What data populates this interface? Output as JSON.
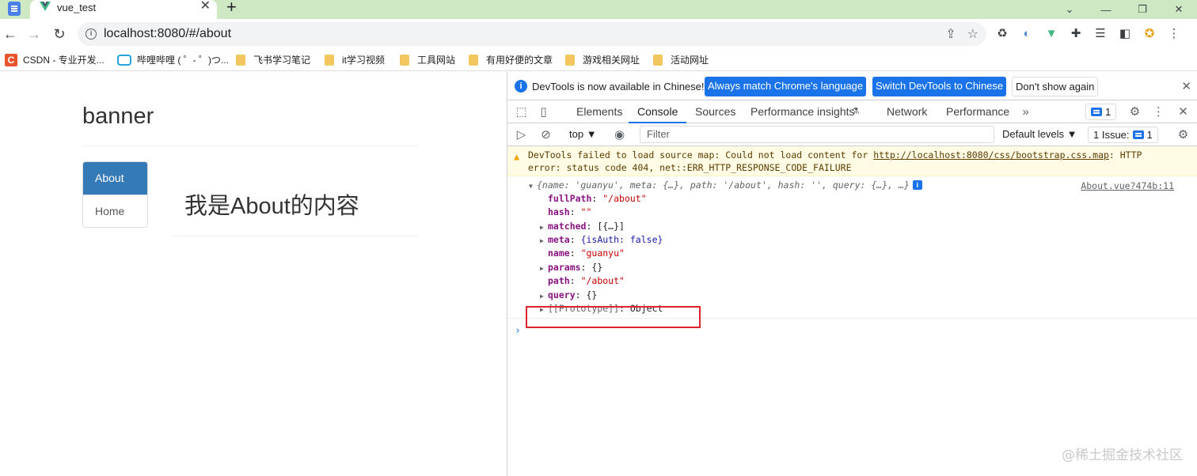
{
  "browser": {
    "tab_title": "vue_test",
    "url": "localhost:8080/#/about",
    "new_tab": "+",
    "close": "✕"
  },
  "bookmarks": [
    {
      "label": "CSDN - 专业开发..."
    },
    {
      "label": "哔哩哔哩 ( ゜- ゜)つ..."
    },
    {
      "label": "飞书学习笔记"
    },
    {
      "label": "it学习视频"
    },
    {
      "label": "工具网站"
    },
    {
      "label": "有用好便的文章"
    },
    {
      "label": "游戏相关网址"
    },
    {
      "label": "活动网址"
    }
  ],
  "page": {
    "banner": "banner",
    "nav": [
      {
        "label": "About",
        "active": true
      },
      {
        "label": "Home",
        "active": false
      }
    ],
    "content": "我是About的内容"
  },
  "devtools": {
    "infobar": {
      "text": "DevTools is now available in Chinese!",
      "btn_match": "Always match Chrome's language",
      "btn_switch": "Switch DevTools to Chinese",
      "btn_dismiss": "Don't show again"
    },
    "tabs": [
      "Elements",
      "Console",
      "Sources",
      "Performance insights",
      "Network",
      "Performance"
    ],
    "active_tab": "Console",
    "message_count": "1",
    "context": "top",
    "filter_placeholder": "Filter",
    "levels": "Default levels",
    "issues": "1 Issue:",
    "issues_count": "1",
    "console": {
      "warning_line1_prefix": "DevTools failed to load source map: Could not load content for ",
      "warning_link": "http://localhost:8080/css/bootstrap.css.map",
      "warning_line1_suffix": ": HTTP",
      "warning_line2": "error: status code 404, net::ERR_HTTP_RESPONSE_CODE_FAILURE",
      "object_summary": "{name: 'guanyu', meta: {…}, path: '/about', hash: '', query: {…}, …}",
      "source": "About.vue?474b:11",
      "props": [
        {
          "key": "fullPath",
          "value": "\"/about\"",
          "expandable": false
        },
        {
          "key": "hash",
          "value": "\"\"",
          "expandable": false
        },
        {
          "key": "matched",
          "value": "[{…}]",
          "expandable": true
        },
        {
          "key": "meta",
          "value": "{isAuth: false}",
          "expandable": true
        },
        {
          "key": "name",
          "value": "\"guanyu\"",
          "expandable": false
        },
        {
          "key": "params",
          "value": "{}",
          "expandable": true
        },
        {
          "key": "path",
          "value": "\"/about\"",
          "expandable": false
        },
        {
          "key": "query",
          "value": "{}",
          "expandable": true
        },
        {
          "key": "[[Prototype]]",
          "value": "Object",
          "expandable": true
        }
      ],
      "prompt": "›"
    }
  },
  "watermark": "@稀土掘金技术社区",
  "colors": {
    "tabstrip": "#cfe8c4",
    "active_nav": "#337ab7",
    "devtools_accent": "#1a73e8",
    "highlight": "#e0242c"
  }
}
